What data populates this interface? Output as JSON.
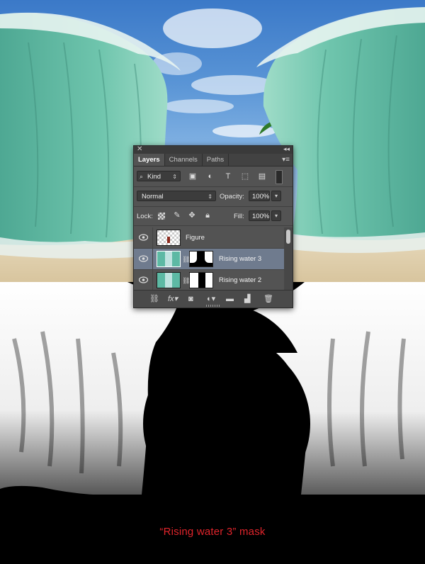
{
  "panel": {
    "tabs": [
      {
        "label": "Layers",
        "active": true
      },
      {
        "label": "Channels",
        "active": false
      },
      {
        "label": "Paths",
        "active": false
      }
    ],
    "filter": {
      "kind_label": "Kind"
    },
    "blend_mode": "Normal",
    "opacity_label": "Opacity:",
    "opacity_value": "100%",
    "lock_label": "Lock:",
    "fill_label": "Fill:",
    "fill_value": "100%",
    "layers": [
      {
        "name": "Figure",
        "visible": true,
        "selected": false,
        "has_mask": false
      },
      {
        "name": "Rising water 3",
        "visible": true,
        "selected": true,
        "has_mask": true
      },
      {
        "name": "Rising water 2",
        "visible": true,
        "selected": false,
        "has_mask": true
      }
    ],
    "icons": {
      "close": "close-icon",
      "collapse": "double-chevron-icon",
      "menu": "panel-menu-icon",
      "search": "search-icon",
      "filter_pixel": "image-filter-icon",
      "filter_adjust": "adjustment-filter-icon",
      "filter_type": "type-filter-icon",
      "filter_shape": "shape-filter-icon",
      "filter_smart": "smart-object-filter-icon",
      "filter_toggle": "filter-toggle-icon",
      "lock_transparent": "lock-transparent-icon",
      "lock_paint": "brush-icon",
      "lock_move": "move-icon",
      "lock_all": "lock-icon",
      "link": "link-icon",
      "fx": "fx-icon",
      "mask": "add-mask-icon",
      "adjust": "adjustment-layer-icon",
      "group": "folder-icon",
      "new_layer": "new-layer-icon",
      "trash": "trash-icon"
    }
  },
  "caption": "“Rising water 3” mask",
  "colors": {
    "caption": "#e0242b",
    "panel_bg": "#535353",
    "selected_row": "#6f7b8e",
    "water": "#5fb9a3",
    "sky": "#4a88d0"
  }
}
